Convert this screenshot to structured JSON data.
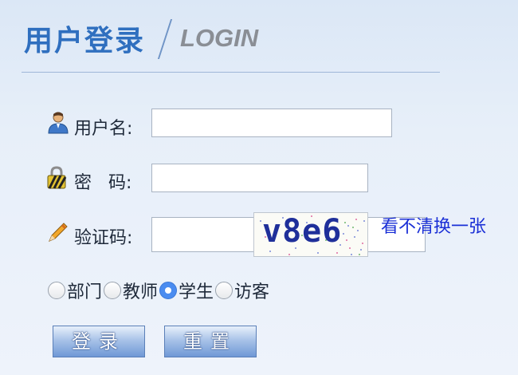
{
  "header": {
    "title_zh": "用户登录",
    "title_en": "LOGIN"
  },
  "form": {
    "username": {
      "label": "用户名:",
      "value": "",
      "icon": "user-icon"
    },
    "password": {
      "label": "密   码:",
      "value": "",
      "icon": "lock-icon"
    },
    "captcha": {
      "label": "验证码:",
      "value": "",
      "icon": "pencil-icon",
      "image_text": "v8e6",
      "refresh_link": "看不清换一张"
    }
  },
  "roles": {
    "selected": "学生",
    "options": [
      "部门",
      "教师",
      "学生",
      "访客"
    ]
  },
  "buttons": {
    "login": "登录",
    "reset": "重置"
  },
  "colors": {
    "title": "#2f6fbf",
    "link": "#1a2fd6",
    "radio_checked": "#4a8cf0"
  }
}
